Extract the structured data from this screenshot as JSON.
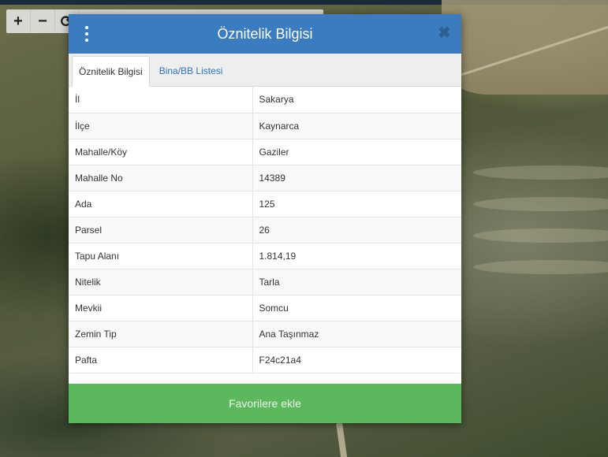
{
  "toolbar": {
    "zoom_in": "+",
    "zoom_out": "−",
    "refresh": "⟳"
  },
  "dialog": {
    "title": "Öznitelik Bilgisi",
    "tabs": [
      {
        "label": "Öznitelik Bilgisi",
        "active": true
      },
      {
        "label": "Bina/BB Listesi",
        "active": false
      }
    ],
    "rows": [
      {
        "key": "İl",
        "value": "Sakarya"
      },
      {
        "key": "İlçe",
        "value": "Kaynarca"
      },
      {
        "key": "Mahalle/Köy",
        "value": "Gaziler"
      },
      {
        "key": "Mahalle No",
        "value": "14389"
      },
      {
        "key": "Ada",
        "value": "125"
      },
      {
        "key": "Parsel",
        "value": "26"
      },
      {
        "key": "Tapu Alanı",
        "value": "1.814,19"
      },
      {
        "key": "Nitelik",
        "value": "Tarla"
      },
      {
        "key": "Mevkii",
        "value": "Somcu"
      },
      {
        "key": "Zemin Tip",
        "value": "Ana Taşınmaz"
      },
      {
        "key": "Pafta",
        "value": "F24c21a4"
      }
    ],
    "favorite_label": "Favorilere ekle"
  },
  "colors": {
    "header": "#3b7cc0",
    "tab_link": "#2f74c0",
    "favorite_button": "#5cb85c"
  },
  "icons": [
    "kebab-menu-icon",
    "close-icon",
    "zoom-in-icon",
    "zoom-out-icon",
    "refresh-icon"
  ]
}
